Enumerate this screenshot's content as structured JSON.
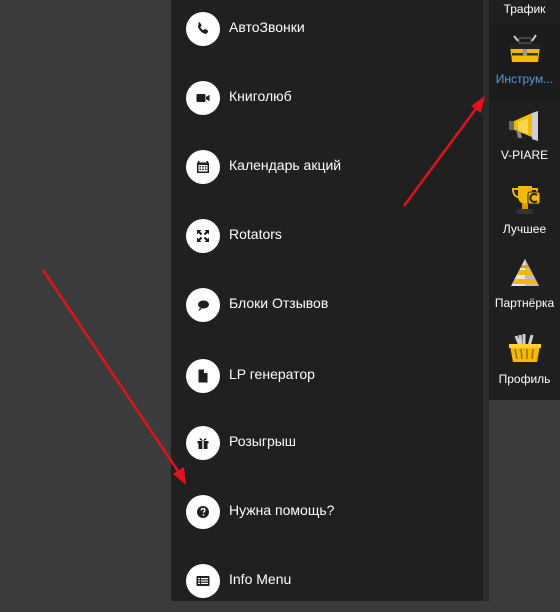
{
  "menu": {
    "items": [
      {
        "label": "АвтоЗвонки",
        "icon": "phone-icon"
      },
      {
        "label": "Книголюб",
        "icon": "video-camera-icon"
      },
      {
        "label": "Календарь акций",
        "icon": "calendar-icon"
      },
      {
        "label": "Rotators",
        "icon": "expand-arrows-icon"
      },
      {
        "label": "Блоки Отзывов",
        "icon": "chat-bubble-icon"
      },
      {
        "label": "LP генератор",
        "icon": "file-icon"
      },
      {
        "label": "Розыгрыш",
        "icon": "gift-icon"
      },
      {
        "label": "Нужна помощь?",
        "icon": "question-icon"
      },
      {
        "label": "Info Menu",
        "icon": "list-icon"
      }
    ]
  },
  "right_sidebar": {
    "items": [
      {
        "label": "Трафик",
        "icon": "traffic-icon"
      },
      {
        "label": "Инструм...",
        "icon": "toolbox-icon",
        "active": true
      },
      {
        "label": "V-PIARE",
        "icon": "megaphone-icon"
      },
      {
        "label": "Лучшее",
        "icon": "trophy-icon"
      },
      {
        "label": "Партнёрка",
        "icon": "pyramid-icon"
      },
      {
        "label": "Профиль",
        "icon": "basket-icon"
      }
    ]
  },
  "colors": {
    "menu_bg": "#202020",
    "page_bg": "#3b3b3b",
    "active_label": "#5b9bd5",
    "arrow": "#e0141e",
    "icon_accent": "#f5b800"
  }
}
